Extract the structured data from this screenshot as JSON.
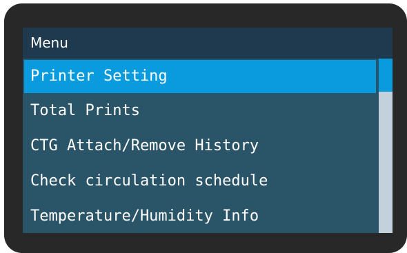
{
  "menu": {
    "title": "Menu",
    "items": [
      {
        "label": "Printer Setting",
        "selected": true
      },
      {
        "label": "Total Prints",
        "selected": false
      },
      {
        "label": "CTG Attach/Remove History",
        "selected": false
      },
      {
        "label": "Check circulation schedule",
        "selected": false
      },
      {
        "label": "Temperature/Humidity Info",
        "selected": false
      }
    ]
  },
  "colors": {
    "bezel": "#282828",
    "title_bar": "#1f3a4e",
    "list_background": "#2a5468",
    "selection": "#0a9bde",
    "scroll_track": "#c3d1dd",
    "text": "#ffffff"
  }
}
